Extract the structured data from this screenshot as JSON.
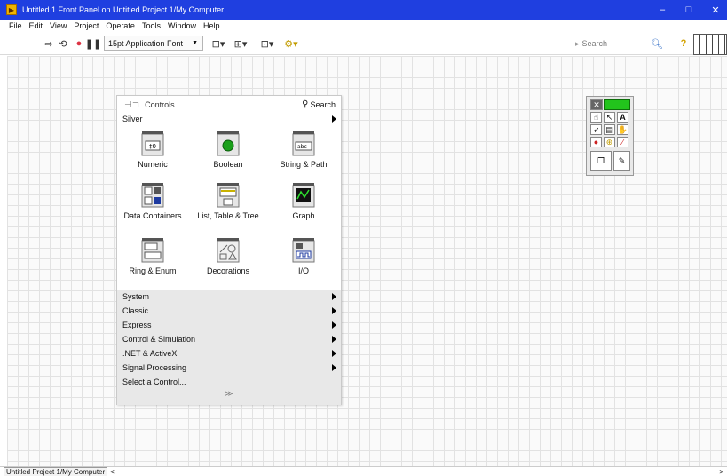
{
  "window": {
    "title": "Untitled 1 Front Panel on Untitled Project 1/My Computer",
    "minimize": "–",
    "maximize": "□",
    "close": "✕"
  },
  "menu": [
    "File",
    "Edit",
    "View",
    "Project",
    "Operate",
    "Tools",
    "Window",
    "Help"
  ],
  "toolbar": {
    "font": "15pt Application Font",
    "search_placeholder": "Search"
  },
  "palette": {
    "title": "Controls",
    "search": "Search",
    "category": "Silver",
    "items": [
      {
        "label": "Numeric",
        "icon": "numeric-icon"
      },
      {
        "label": "Boolean",
        "icon": "boolean-icon"
      },
      {
        "label": "String & Path",
        "icon": "string-path-icon"
      },
      {
        "label": "Data Containers",
        "icon": "data-containers-icon"
      },
      {
        "label": "List, Table & Tree",
        "icon": "list-table-tree-icon"
      },
      {
        "label": "Graph",
        "icon": "graph-icon"
      },
      {
        "label": "Ring & Enum",
        "icon": "ring-enum-icon"
      },
      {
        "label": "Decorations",
        "icon": "decorations-icon"
      },
      {
        "label": "I/O",
        "icon": "io-icon"
      }
    ],
    "subpalettes": [
      "System",
      "Classic",
      "Express",
      "Control & Simulation",
      ".NET & ActiveX",
      "Signal Processing",
      "Select a Control..."
    ],
    "expand": "≫"
  },
  "status": {
    "label": "Untitled Project 1/My Computer",
    "left_arrow": "<",
    "right_arrow": ">"
  },
  "colors": {
    "titlebar": "#1f3fe0",
    "boolean_led": "#1aa01a",
    "tools_green": "#22c41c"
  }
}
